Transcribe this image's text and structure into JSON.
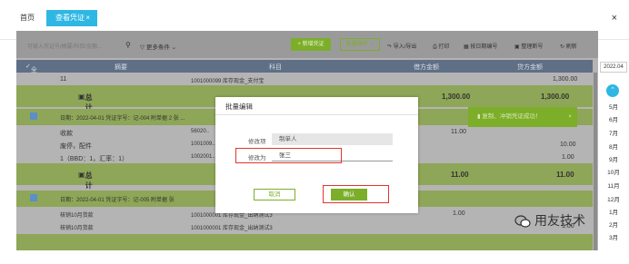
{
  "tabs": {
    "home": "首页",
    "active": "查看凭证",
    "active_close": "×"
  },
  "window_close": "×",
  "toolbar": {
    "search_placeholder": "可输入凭证号/摘要/科目/金额...",
    "more_filter": "更多条件",
    "new_voucher": "+ 新增凭证",
    "batch_ops": "批量操作",
    "import_export": "导入/导出",
    "print": "打印",
    "reorder": "按日期编号",
    "renumber": "整理断号",
    "refresh": "刷新"
  },
  "table_header": {
    "select_all": "全选",
    "summary": "摘要",
    "account": "科目",
    "debit": "借方金额",
    "credit": "贷方金额"
  },
  "rows": {
    "r1_summary": "11",
    "r1_account": "1001000099 库存现金_支付宝",
    "r1_credit": "1,300.00",
    "total_label": "总计",
    "total1_debit": "1,300.00",
    "total1_credit": "1,300.00",
    "v2_header": "日期：2022-04-01   凭证字号：记-004   附单据 2 张   ...",
    "v2_r1_summary": "收款",
    "v2_r1_account": "56020..",
    "v2_r1_debit": "11.00",
    "v2_r2_summary": "废停，配件",
    "v2_r2_account": "1001009..",
    "v2_r2_credit": "10.00",
    "v2_r3_summary": "1（BBD：1，汇率：1）",
    "v2_r3_account": "1002001..",
    "v2_r3_credit": "1.00",
    "total2_debit": "11.00",
    "total2_credit": "11.00",
    "v3_header": "日期：2022-04-01   凭证字号：记-005   附单据 张",
    "v3_r1_summary": "核销10月货款",
    "v3_r1_account": "1001000001 库存现金_出纳测试3",
    "v3_r1_debit": "1.00",
    "v3_r2_summary": "核销10月货款",
    "v3_r2_account": "1001000001 库存现金_出纳测试3",
    "v3_r2_credit": "1.00"
  },
  "months_panel": {
    "year": "2022.04",
    "months": [
      "5月",
      "6月",
      "7月",
      "8月",
      "9月",
      "10月",
      "11月",
      "12月",
      "1月",
      "2月",
      "3月"
    ]
  },
  "toast": {
    "text": "复制、冲销凭证成功！",
    "close": "×"
  },
  "modal": {
    "title": "批量编辑",
    "field_label": "修改项",
    "field_value": "制单人",
    "change_label": "修改为",
    "change_value": "张三",
    "cancel": "取消",
    "confirm": "确认"
  },
  "watermark": "用友技术",
  "colors": {
    "accent_green": "#7cae2a",
    "tab_blue": "#2fb7e4",
    "highlight_red": "#e4342c"
  }
}
